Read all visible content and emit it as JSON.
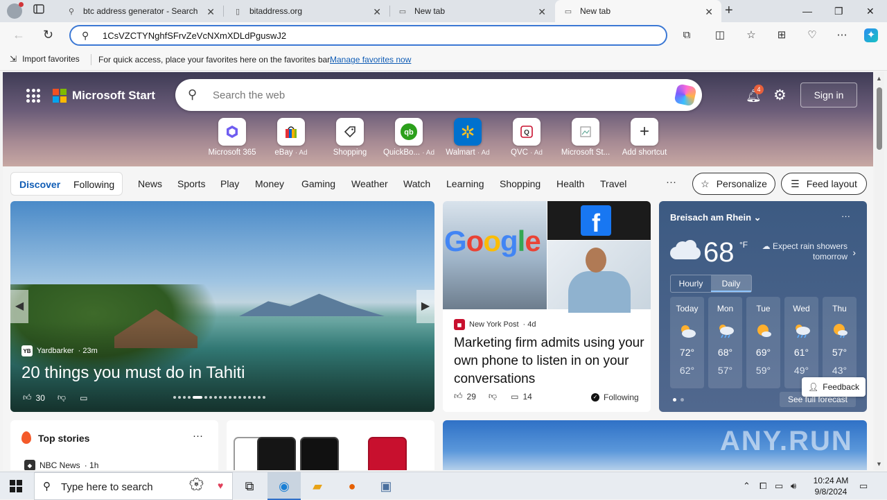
{
  "browser": {
    "tabs": [
      {
        "title": "btc address generator - Search",
        "icon": "search-icon"
      },
      {
        "title": "bitaddress.org",
        "icon": "page-icon"
      },
      {
        "title": "New tab",
        "icon": "newtab-icon"
      },
      {
        "title": "New tab",
        "icon": "newtab-icon",
        "active": true
      }
    ],
    "address": "1CsVZCTYNghfSFrvZeVcNXmXDLdPguswJ2"
  },
  "favbar": {
    "import_label": "Import favorites",
    "message": "For quick access, place your favorites here on the favorites bar.",
    "manage_link": "Manage favorites now"
  },
  "msn": {
    "brand": "Microsoft Start",
    "search_placeholder": "Search the web",
    "notification_count": "4",
    "signin": "Sign in",
    "quicklinks": [
      {
        "label": "Microsoft 365",
        "ad": ""
      },
      {
        "label": "eBay",
        "ad": "· Ad"
      },
      {
        "label": "Shopping",
        "ad": ""
      },
      {
        "label": "QuickBo...",
        "ad": "· Ad"
      },
      {
        "label": "Walmart",
        "ad": "· Ad"
      },
      {
        "label": "QVC",
        "ad": "· Ad"
      },
      {
        "label": "Microsoft St...",
        "ad": ""
      },
      {
        "label": "Add shortcut",
        "ad": ""
      }
    ],
    "feed_tabs": {
      "discover": "Discover",
      "following": "Following"
    },
    "nav": [
      "News",
      "Sports",
      "Play",
      "Money",
      "Gaming",
      "Weather",
      "Watch",
      "Learning",
      "Shopping",
      "Health",
      "Travel"
    ],
    "more": "···",
    "personalize": "Personalize",
    "feed_layout": "Feed layout"
  },
  "hero": {
    "source": "Yardbarker",
    "source_logo": "YB",
    "age": "· 23m",
    "title": "20 things you must do in Tahiti",
    "likes": "30"
  },
  "news": {
    "source": "New York Post",
    "age": "· 4d",
    "title": "Marketing firm admits using your own phone to listen in on your conversations",
    "likes": "29",
    "comments": "14",
    "following": "Following",
    "image_text": "Google"
  },
  "weather": {
    "location": "Breisach am Rhein",
    "temp": "68",
    "unit": "°F",
    "summary": "Expect rain showers tomorrow",
    "tab_hourly": "Hourly",
    "tab_daily": "Daily",
    "forecast": [
      {
        "day": "Today",
        "hi": "72°",
        "lo": "62°"
      },
      {
        "day": "Mon",
        "hi": "68°",
        "lo": "57°"
      },
      {
        "day": "Tue",
        "hi": "69°",
        "lo": "59°"
      },
      {
        "day": "Wed",
        "hi": "61°",
        "lo": "49°"
      },
      {
        "day": "Thu",
        "hi": "57°",
        "lo": "43°"
      }
    ],
    "see_full": "See full forecast"
  },
  "top_stories": {
    "title": "Top stories",
    "first_source": "NBC News",
    "first_age": "· 1h"
  },
  "feedback": "Feedback",
  "watermark": "ANY.RUN",
  "taskbar": {
    "search_placeholder": "Type here to search",
    "time": "10:24 AM",
    "date": "9/8/2024"
  },
  "colors": {
    "accent": "#3b78d4",
    "weather_bg": "#3c5a82",
    "ms_red": "#f25022",
    "ms_green": "#7fba00",
    "ms_blue": "#00a4ef",
    "ms_yellow": "#ffb900"
  }
}
